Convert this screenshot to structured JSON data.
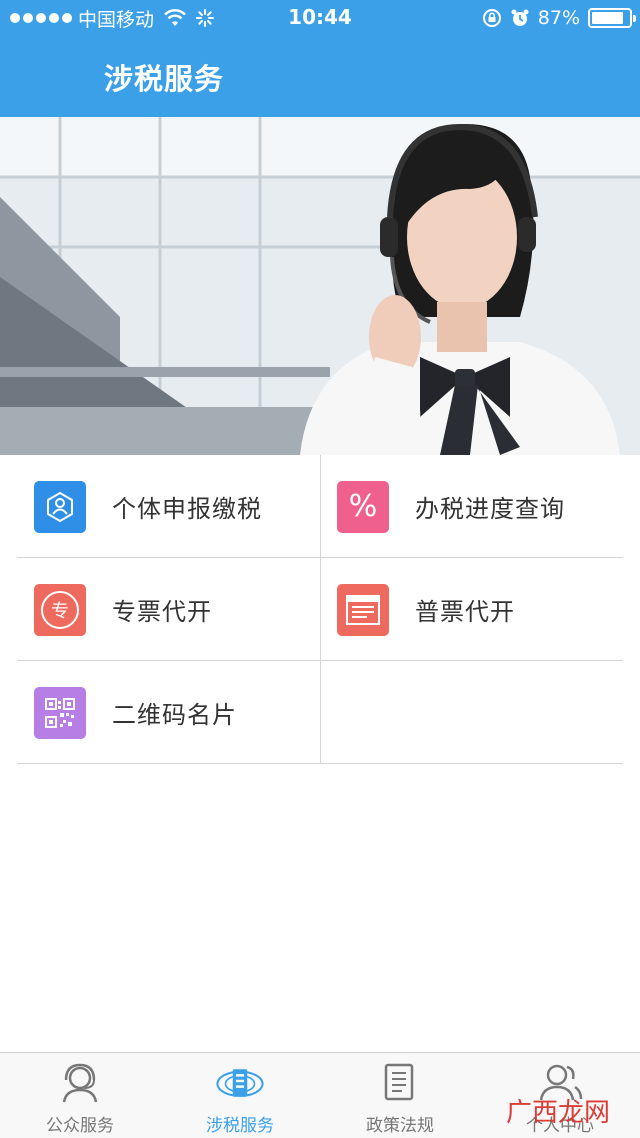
{
  "status_bar": {
    "carrier": "中国移动",
    "time": "10:44",
    "battery": "87%",
    "battery_level": 0.87,
    "icons": [
      "signal-icon",
      "wifi-icon",
      "activity-spinner-icon",
      "rotation-lock-icon",
      "alarm-icon",
      "battery-icon"
    ]
  },
  "header": {
    "title": "涉税服务"
  },
  "banner": {
    "image": "customer-service-agent-with-headset"
  },
  "services": [
    {
      "label": "个体申报缴税",
      "icon": "person-declare-icon",
      "color": "#2f8fe6"
    },
    {
      "label": "办税进度查询",
      "icon": "percent-icon",
      "color": "#f0608e",
      "glyph": "%"
    },
    {
      "label": "专票代开",
      "icon": "special-invoice-icon",
      "color": "#ef6a5e",
      "glyph": "专"
    },
    {
      "label": "普票代开",
      "icon": "invoice-icon",
      "color": "#ef6a5e"
    },
    {
      "label": "二维码名片",
      "icon": "qrcode-icon",
      "color": "#b77ee6"
    }
  ],
  "tabbar": {
    "active_color": "#3ba0e8",
    "tabs": [
      {
        "label": "公众服务",
        "icon": "headset-user-icon",
        "active": false
      },
      {
        "label": "涉税服务",
        "icon": "tax-emblem-icon",
        "active": true
      },
      {
        "label": "政策法规",
        "icon": "document-icon",
        "active": false
      },
      {
        "label": "个人中心",
        "icon": "users-icon",
        "active": false
      }
    ]
  },
  "watermark": "广西龙网"
}
